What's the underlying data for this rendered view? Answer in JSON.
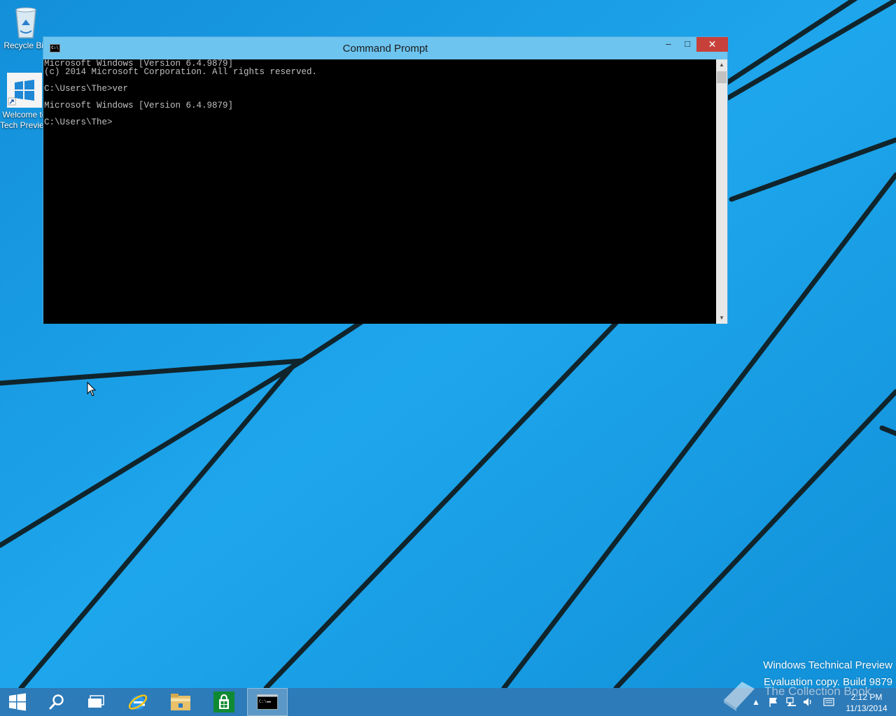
{
  "desktop": {
    "icons": [
      {
        "label": "Recycle Bin",
        "icon": "recycle-bin-icon"
      },
      {
        "label_line1": "Welcome to",
        "label_line2": "Tech Preview",
        "icon": "windows-logo-icon"
      }
    ]
  },
  "window": {
    "title": "Command Prompt",
    "icon": "cmd-icon",
    "minimize": "–",
    "maximize": "□",
    "close": "✕",
    "console_lines": [
      "Microsoft Windows [Version 6.4.9879]",
      "(c) 2014 Microsoft Corporation. All rights reserved.",
      "",
      "C:\\Users\\The>ver",
      "",
      "Microsoft Windows [Version 6.4.9879]",
      "",
      "C:\\Users\\The>"
    ]
  },
  "watermark": {
    "line1": "Windows Technical Preview",
    "line2": "Evaluation copy. Build 9879",
    "overlay": "The Collection Book"
  },
  "taskbar": {
    "items": [
      "start-button",
      "search-button",
      "task-view-button",
      "internet-explorer",
      "file-explorer",
      "store",
      "command-prompt"
    ],
    "clock": {
      "time": "2:12 PM",
      "date": "11/13/2014"
    }
  },
  "colors": {
    "desktop": "#1a9be6",
    "titlebar": "#6cc4ef",
    "close": "#c7413a",
    "taskbar": "#2d7bb8"
  }
}
